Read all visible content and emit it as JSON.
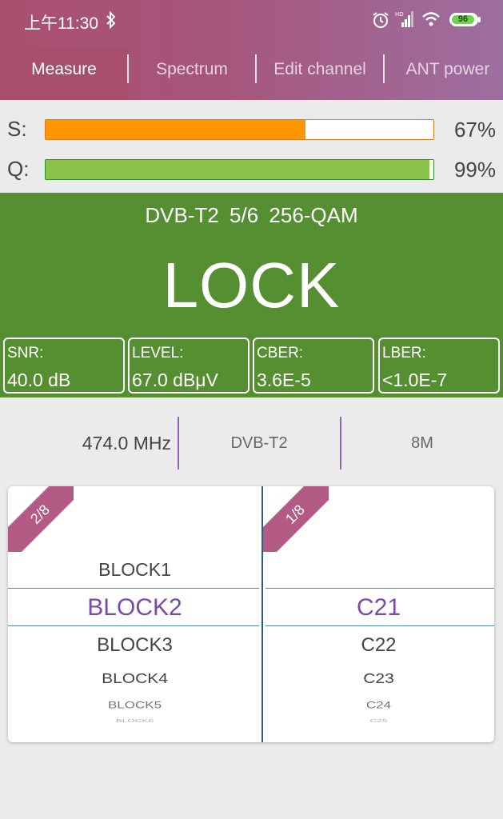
{
  "status_bar": {
    "time": "上午11:30",
    "battery": "96"
  },
  "tabs": [
    {
      "label": "Measure",
      "active": true
    },
    {
      "label": "Spectrum",
      "active": false
    },
    {
      "label": "Edit channel",
      "active": false
    },
    {
      "label": "ANT power",
      "active": false
    }
  ],
  "meters": {
    "strength": {
      "label": "S:",
      "percent": "67%",
      "value": 67,
      "color": "#ff9500"
    },
    "quality": {
      "label": "Q:",
      "percent": "99%",
      "value": 99,
      "color": "#8bc34a"
    }
  },
  "lock": {
    "modulation": "DVB-T2  5/6  256-QAM",
    "status": "LOCK",
    "color": "#558f31"
  },
  "stats": [
    {
      "label": "SNR:",
      "value": "40.0 dB"
    },
    {
      "label": "LEVEL:",
      "value": "67.0 dBμV"
    },
    {
      "label": "CBER:",
      "value": "3.6E-5"
    },
    {
      "label": "LBER:",
      "value": "<1.0E-7"
    }
  ],
  "channel_info": {
    "frequency": "474.0 MHz",
    "standard": "DVB-T2",
    "bandwidth": "8M"
  },
  "pickers": {
    "block": {
      "page": "2/8",
      "items": [
        "BLOCK1",
        "BLOCK2",
        "BLOCK3",
        "BLOCK4",
        "BLOCK5",
        "BLOCK6"
      ],
      "selected": "BLOCK2"
    },
    "channel": {
      "page": "1/8",
      "items": [
        "C21",
        "C22",
        "C23",
        "C24",
        "C25"
      ],
      "selected": "C21"
    }
  },
  "colors": {
    "accent": "#7a4aa6",
    "ribbon": "#b35b84",
    "header": "#a9506f"
  }
}
